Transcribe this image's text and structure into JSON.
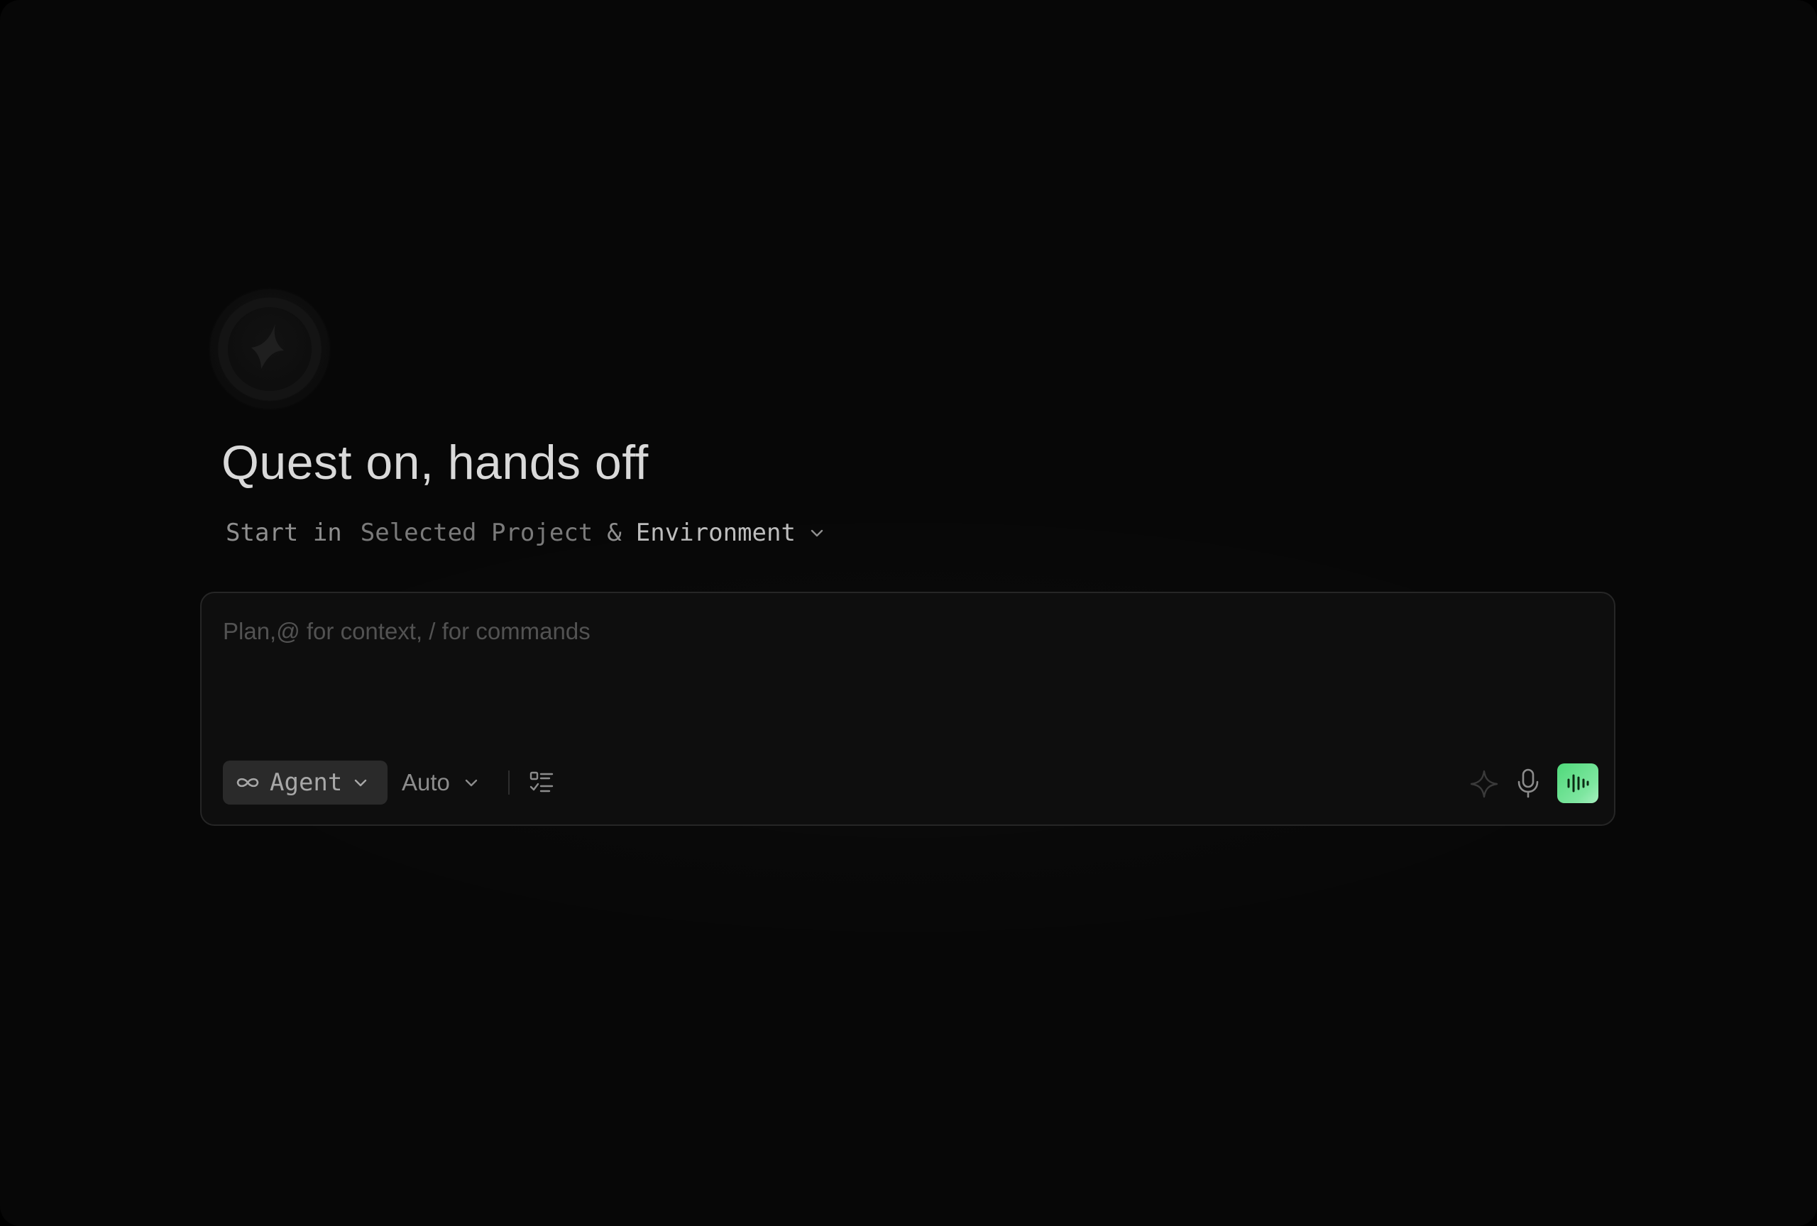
{
  "hero": {
    "title": "Quest on, hands off",
    "start_label": "Start in",
    "env_project": "Selected Project",
    "env_amp": "&",
    "env_env": "Environment"
  },
  "composer": {
    "placeholder": "Plan,@ for context, / for commands",
    "value": "",
    "mode_label": "Agent",
    "model_label": "Auto"
  },
  "icons": {
    "logo": "star-logo-icon",
    "mode": "infinity-icon",
    "tasks": "checklist-icon",
    "enhance": "sparkle-icon",
    "mic": "microphone-icon",
    "voice": "audio-wave-icon"
  },
  "colors": {
    "background": "#070707",
    "accent_green": "#4fd97a"
  }
}
